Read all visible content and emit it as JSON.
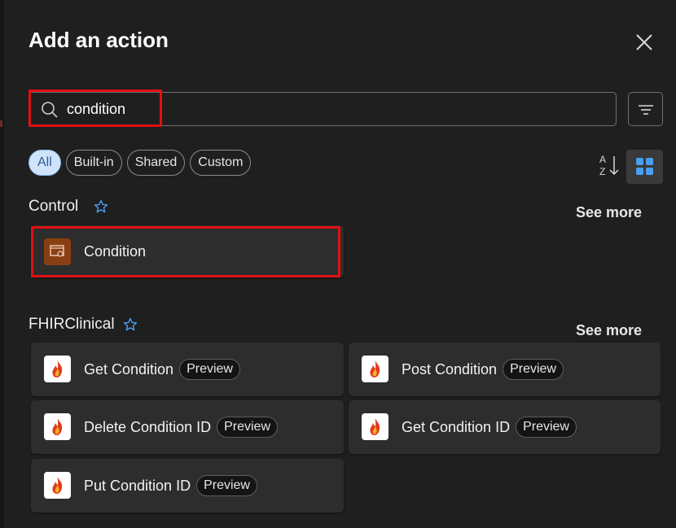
{
  "dialog": {
    "title": "Add an action"
  },
  "search": {
    "value": "condition",
    "icon": "search-icon"
  },
  "filters": {
    "chips": [
      {
        "label": "All",
        "active": true
      },
      {
        "label": "Built-in",
        "active": false
      },
      {
        "label": "Shared",
        "active": false
      },
      {
        "label": "Custom",
        "active": false
      }
    ]
  },
  "colors": {
    "highlight": "#e01010",
    "accent": "#4a9ff5",
    "control_icon": "#8a3f12"
  },
  "sections": {
    "control": {
      "title": "Control",
      "see_more": "See more",
      "items": [
        {
          "label": "Condition",
          "icon": "condition-icon"
        }
      ]
    },
    "fhir": {
      "title": "FHIRClinical",
      "see_more": "See more",
      "items": [
        {
          "label": "Get Condition",
          "badge": "Preview",
          "icon": "fhir-flame-icon"
        },
        {
          "label": "Post Condition",
          "badge": "Preview",
          "icon": "fhir-flame-icon"
        },
        {
          "label": "Delete Condition ID",
          "badge": "Preview",
          "icon": "fhir-flame-icon"
        },
        {
          "label": "Get Condition ID",
          "badge": "Preview",
          "icon": "fhir-flame-icon"
        },
        {
          "label": "Put Condition ID",
          "badge": "Preview",
          "icon": "fhir-flame-icon"
        }
      ]
    }
  }
}
